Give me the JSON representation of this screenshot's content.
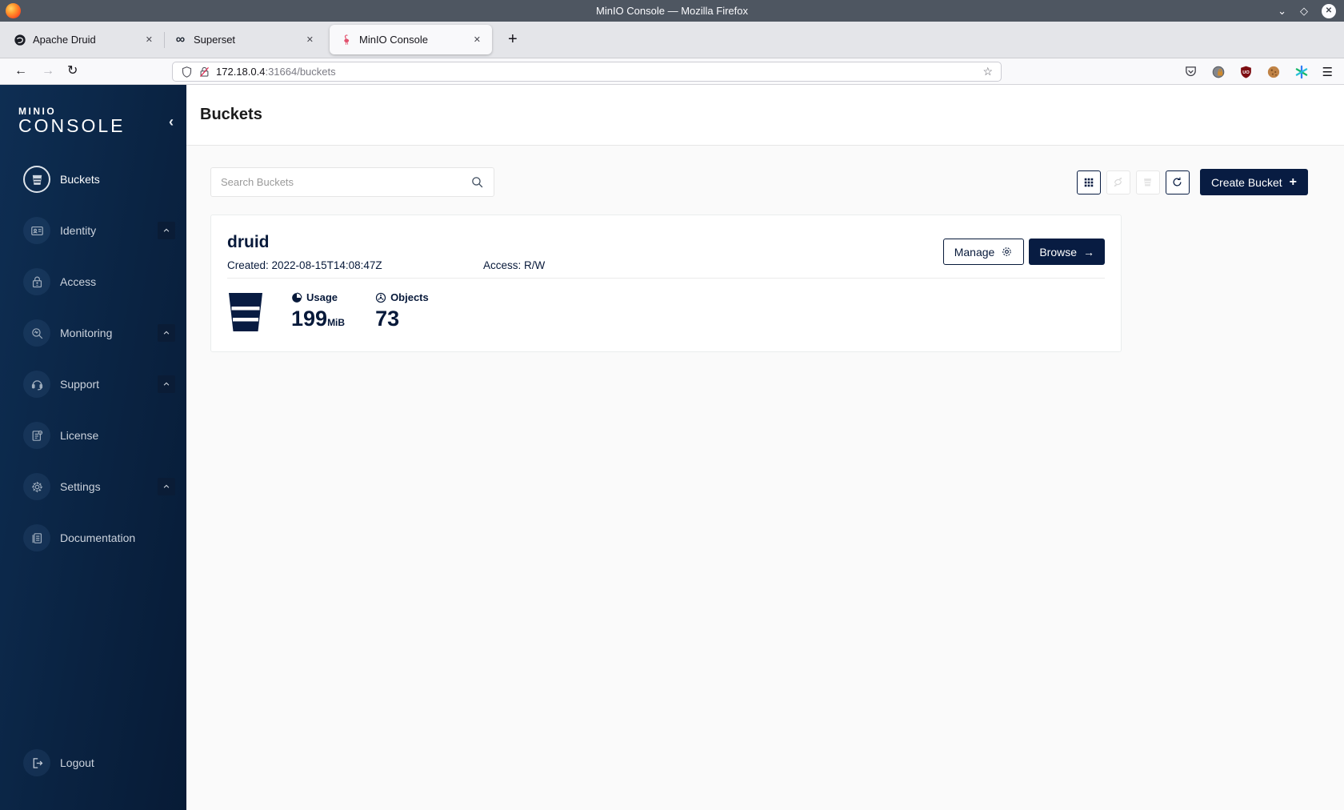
{
  "window": {
    "title": "MinIO Console — Mozilla Firefox"
  },
  "browser": {
    "tabs": [
      {
        "label": "Apache Druid"
      },
      {
        "label": "Superset"
      },
      {
        "label": "MinIO Console"
      }
    ],
    "url": {
      "host": "172.18.0.4",
      "rest": ":31664/buckets"
    }
  },
  "glyphs": {
    "win_min": "⌄",
    "win_max": "◇",
    "win_close": "✕",
    "close_tab": "✕",
    "new_tab": "+",
    "back": "←",
    "forward": "→",
    "reload": "↻",
    "star": "☆",
    "menu": "☰",
    "infinity": "∞",
    "collapse": "‹",
    "plus": "+",
    "arrow_right": "→"
  },
  "sidebar": {
    "logo_top": "MINIO",
    "logo_bottom": "CONSOLE",
    "items": [
      {
        "label": "Buckets"
      },
      {
        "label": "Identity"
      },
      {
        "label": "Access"
      },
      {
        "label": "Monitoring"
      },
      {
        "label": "Support"
      },
      {
        "label": "License"
      },
      {
        "label": "Settings"
      },
      {
        "label": "Documentation"
      }
    ],
    "logout_label": "Logout"
  },
  "page": {
    "title": "Buckets",
    "search_placeholder": "Search Buckets",
    "create_button": "Create Bucket",
    "bucket": {
      "name": "druid",
      "created_label": "Created: 2022-08-15T14:08:47Z",
      "access_label": "Access: R/W",
      "manage_button": "Manage",
      "browse_button": "Browse",
      "usage_label": "Usage",
      "usage_value": "199",
      "usage_unit": "MiB",
      "objects_label": "Objects",
      "objects_value": "73"
    }
  },
  "colors": {
    "navy": "#081C42",
    "sidebar_start": "#0e2e53",
    "sidebar_end": "#071b36",
    "accent_red": "#e22850"
  }
}
